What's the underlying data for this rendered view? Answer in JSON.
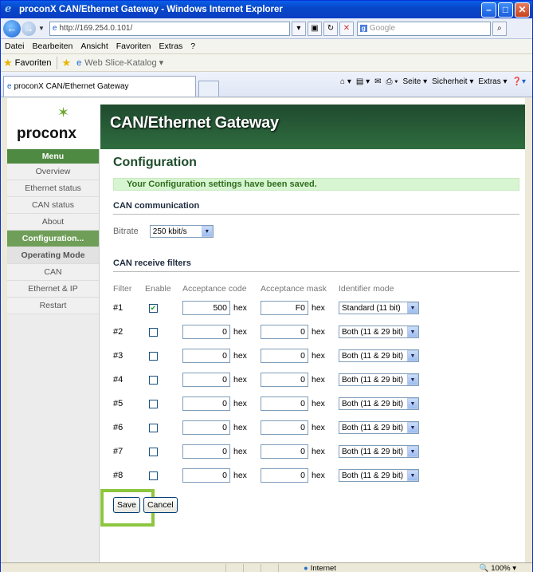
{
  "window": {
    "title": "proconX CAN/Ethernet Gateway - Windows Internet Explorer"
  },
  "address": {
    "url": "http://169.254.0.101/",
    "search_placeholder": "Google"
  },
  "menubar": [
    "Datei",
    "Bearbeiten",
    "Ansicht",
    "Favoriten",
    "Extras",
    "?"
  ],
  "favbar": {
    "favorites": "Favoriten",
    "web_slice": "Web Slice-Katalog ▾"
  },
  "tab": {
    "title": "proconX CAN/Ethernet Gateway"
  },
  "commandbar": [
    "Seite ▾",
    "Sicherheit ▾",
    "Extras ▾"
  ],
  "logo": {
    "text": "proconx"
  },
  "banner": {
    "title": "CAN/Ethernet Gateway"
  },
  "sidebar": {
    "heading": "Menu",
    "items": [
      "Overview",
      "Ethernet status",
      "CAN status",
      "About",
      "Configuration...",
      "Operating Mode",
      "CAN",
      "Ethernet & IP",
      "Restart"
    ],
    "active": "Configuration..."
  },
  "content": {
    "title": "Configuration",
    "saved_message": "Your Configuration settings have been saved.",
    "can_section": "CAN communication",
    "bitrate_label": "Bitrate",
    "bitrate_value": "250 kbit/s",
    "filters_section": "CAN receive filters",
    "columns": [
      "Filter",
      "Enable",
      "Acceptance code",
      "Acceptance mask",
      "Identifier mode"
    ],
    "filters": [
      {
        "id": "#1",
        "enabled": true,
        "code": "500",
        "mask": "F0",
        "mode": "Standard (11 bit)"
      },
      {
        "id": "#2",
        "enabled": false,
        "code": "0",
        "mask": "0",
        "mode": "Both (11 & 29 bit)"
      },
      {
        "id": "#3",
        "enabled": false,
        "code": "0",
        "mask": "0",
        "mode": "Both (11 & 29 bit)"
      },
      {
        "id": "#4",
        "enabled": false,
        "code": "0",
        "mask": "0",
        "mode": "Both (11 & 29 bit)"
      },
      {
        "id": "#5",
        "enabled": false,
        "code": "0",
        "mask": "0",
        "mode": "Both (11 & 29 bit)"
      },
      {
        "id": "#6",
        "enabled": false,
        "code": "0",
        "mask": "0",
        "mode": "Both (11 & 29 bit)"
      },
      {
        "id": "#7",
        "enabled": false,
        "code": "0",
        "mask": "0",
        "mode": "Both (11 & 29 bit)"
      },
      {
        "id": "#8",
        "enabled": false,
        "code": "0",
        "mask": "0",
        "mode": "Both (11 & 29 bit)"
      }
    ],
    "hex_suffix": "hex",
    "save_label": "Save",
    "cancel_label": "Cancel"
  },
  "status": {
    "zone": "Internet",
    "zoom": "100%"
  },
  "colors": {
    "accent": "#1e4d2b",
    "highlight": "#8cc63e",
    "menu_active": "#6f9e58"
  }
}
